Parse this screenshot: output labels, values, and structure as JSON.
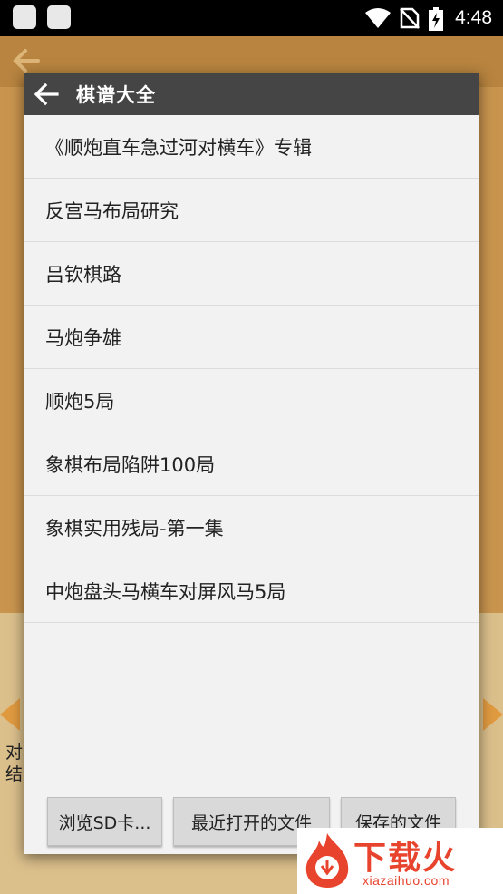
{
  "status_bar": {
    "time": "4:48",
    "icons": [
      "notification-square-icon",
      "notification-square-icon",
      "wifi-icon",
      "no-sim-icon",
      "battery-charging-icon"
    ]
  },
  "background": {
    "side_text": "对结"
  },
  "dialog": {
    "title": "棋谱大全",
    "items": [
      "《顺炮直车急过河对横车》专辑",
      "反宫马布局研究",
      "吕钦棋路",
      "马炮争雄",
      "顺炮5局",
      "象棋布局陷阱100局",
      "象棋实用残局-第一集",
      "中炮盘头马横车对屏风马5局"
    ],
    "buttons": {
      "browse_sd": "浏览SD卡...",
      "recent_files": "最近打开的文件",
      "saved_files": "保存的文件"
    }
  },
  "watermark": {
    "brand": "下载火",
    "url": "xiazaihuo.com"
  },
  "colors": {
    "header": "#454545",
    "dialog_bg": "#f2f2f2",
    "watermark": "#e8432c"
  }
}
